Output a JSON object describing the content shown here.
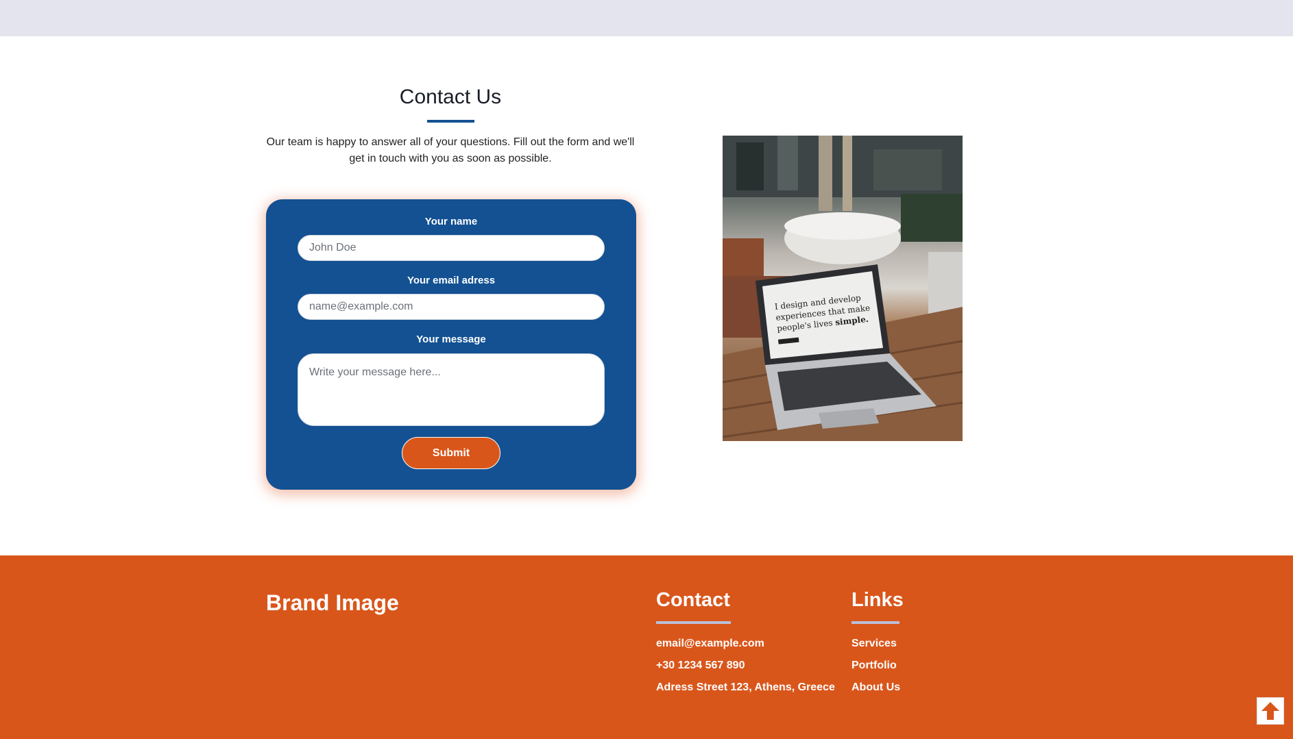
{
  "contact": {
    "title": "Contact Us",
    "description": "Our team is happy to answer all of your questions. Fill out the form and we'll get in touch with you as soon as possible.",
    "form": {
      "name_label": "Your name",
      "name_placeholder": "John Doe",
      "email_label": "Your email adress",
      "email_placeholder": "name@example.com",
      "message_label": "Your message",
      "message_placeholder": "Write your message here...",
      "submit_label": "Submit"
    },
    "image": {
      "screen_text": [
        "I design and develop",
        "experiences that make",
        "people's lives"
      ],
      "screen_emphasis": "simple."
    }
  },
  "footer": {
    "brand": "Brand Image",
    "contact": {
      "title": "Contact",
      "email": "email@example.com",
      "phone": "+30 1234 567 890",
      "address": "Adress Street 123, Athens, Greece"
    },
    "links": {
      "title": "Links",
      "items": [
        "Services",
        "Portfolio",
        "About Us"
      ]
    }
  },
  "colors": {
    "primary_blue": "#135192",
    "accent_orange": "#d9561b",
    "top_bar": "#e3e4ee"
  },
  "icons": {
    "scroll_top": "arrow-up-icon"
  }
}
